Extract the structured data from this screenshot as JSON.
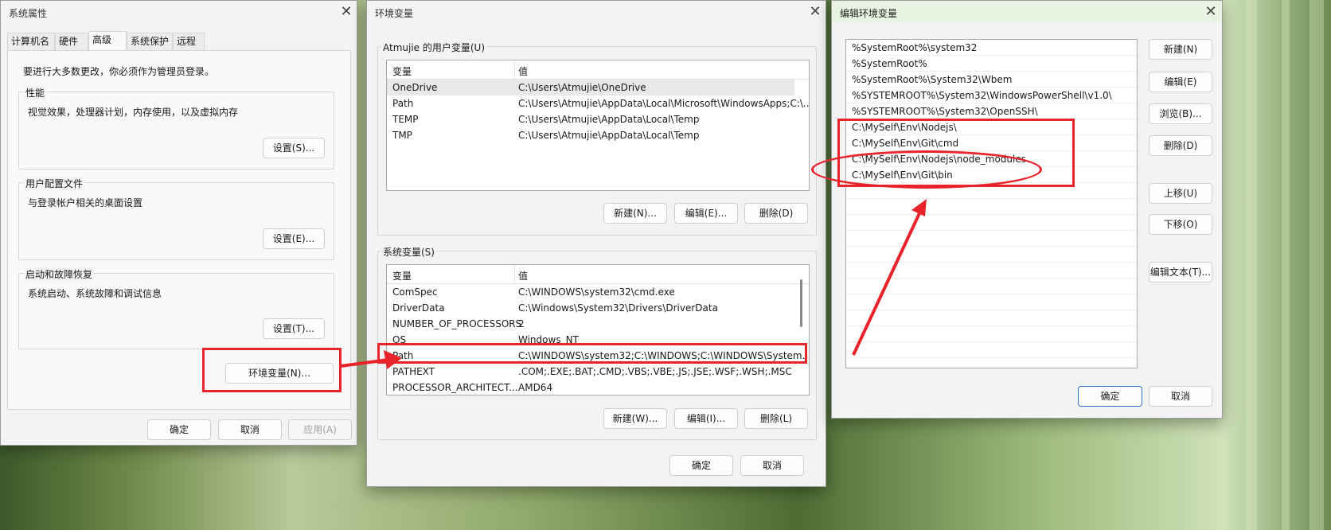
{
  "sysprops": {
    "title": "系统属性",
    "tabs": [
      "计算机名",
      "硬件",
      "高级",
      "系统保护",
      "远程"
    ],
    "admin_note": "要进行大多数更改，你必须作为管理员登录。",
    "perf": {
      "label": "性能",
      "desc": "视觉效果，处理器计划，内存使用，以及虚拟内存",
      "btn": "设置(S)..."
    },
    "profile": {
      "label": "用户配置文件",
      "desc": "与登录帐户相关的桌面设置",
      "btn": "设置(E)..."
    },
    "startup": {
      "label": "启动和故障恢复",
      "desc": "系统启动、系统故障和调试信息",
      "btn": "设置(T)..."
    },
    "env_btn": "环境变量(N)...",
    "ok": "确定",
    "cancel": "取消",
    "apply": "应用(A)"
  },
  "envvars": {
    "title": "环境变量",
    "user": {
      "label": "Atmujie 的用户变量(U)",
      "header": [
        "变量",
        "值"
      ],
      "rows": [
        [
          "OneDrive",
          "C:\\Users\\Atmujie\\OneDrive"
        ],
        [
          "Path",
          "C:\\Users\\Atmujie\\AppData\\Local\\Microsoft\\WindowsApps;C:\\..."
        ],
        [
          "TEMP",
          "C:\\Users\\Atmujie\\AppData\\Local\\Temp"
        ],
        [
          "TMP",
          "C:\\Users\\Atmujie\\AppData\\Local\\Temp"
        ]
      ],
      "new": "新建(N)...",
      "edit": "编辑(E)...",
      "delete": "删除(D)"
    },
    "system": {
      "label": "系统变量(S)",
      "header": [
        "变量",
        "值"
      ],
      "rows": [
        [
          "ComSpec",
          "C:\\WINDOWS\\system32\\cmd.exe"
        ],
        [
          "DriverData",
          "C:\\Windows\\System32\\Drivers\\DriverData"
        ],
        [
          "NUMBER_OF_PROCESSORS",
          "2"
        ],
        [
          "OS",
          "Windows_NT"
        ],
        [
          "Path",
          "C:\\WINDOWS\\system32;C:\\WINDOWS;C:\\WINDOWS\\System..."
        ],
        [
          "PATHEXT",
          ".COM;.EXE;.BAT;.CMD;.VBS;.VBE;.JS;.JSE;.WSF;.WSH;.MSC"
        ],
        [
          "PROCESSOR_ARCHITECT...",
          "AMD64"
        ]
      ],
      "new": "新建(W)...",
      "edit": "编辑(I)...",
      "delete": "删除(L)"
    },
    "ok": "确定",
    "cancel": "取消"
  },
  "editenv": {
    "title": "编辑环境变量",
    "entries": [
      "%SystemRoot%\\system32",
      "%SystemRoot%",
      "%SystemRoot%\\System32\\Wbem",
      "%SYSTEMROOT%\\System32\\WindowsPowerShell\\v1.0\\",
      "%SYSTEMROOT%\\System32\\OpenSSH\\",
      "C:\\MySelf\\Env\\Nodejs\\",
      "C:\\MySelf\\Env\\Git\\cmd",
      "C:\\MySelf\\Env\\Nodejs\\node_modules",
      "C:\\MySelf\\Env\\Git\\bin"
    ],
    "buttons": {
      "new": "新建(N)",
      "edit": "编辑(E)",
      "browse": "浏览(B)...",
      "delete": "删除(D)",
      "up": "上移(U)",
      "down": "下移(O)",
      "edit_text": "编辑文本(T)..."
    },
    "ok": "确定",
    "cancel": "取消"
  },
  "colors": {
    "annotation": "#e8232a",
    "primary_border": "#2f6fc7"
  },
  "icons": {
    "close": "close-icon"
  }
}
